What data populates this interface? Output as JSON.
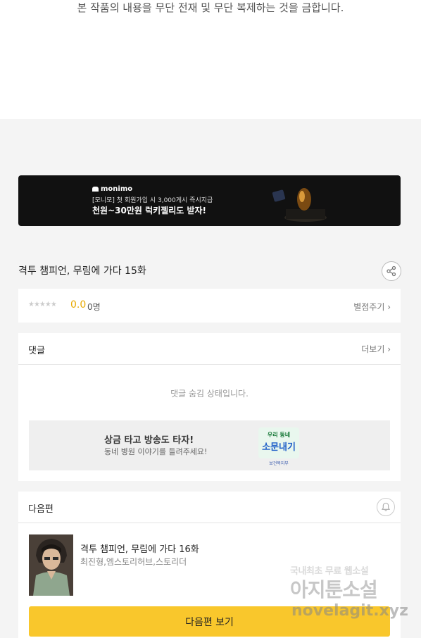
{
  "notice": {
    "copyright": "본 작품의 내용을 무단 전재 및 무단 복제하는 것을 금합니다."
  },
  "banner": {
    "brand": "monimo",
    "sub": "[모니모] 첫 회원가입 시 3,000게시 즉시지급",
    "main": "천원~30만원 럭키젤리도 받자!"
  },
  "episode": {
    "title": "격투 챔피언, 무림에 가다 15화"
  },
  "rating": {
    "stars": "★★★★★",
    "score": "0.0",
    "count": "0명",
    "rate_link": "별점주기 ›"
  },
  "comments": {
    "label": "댓글",
    "more_link": "더보기 ›",
    "hidden_message": "댓글 숨김 상태입니다.",
    "promo_title": "상금 타고 방송도 타자!",
    "promo_sub": "동네 병원 이야기를 들려주세요!",
    "promo_logo": [
      "우리 동네",
      "소문내기"
    ],
    "promo_org": "보건복지부"
  },
  "next": {
    "label": "다음편",
    "title": "격투 챔피언, 무림에 가다 16화",
    "authors": "최진형,엠스토리허브,스토리더",
    "button": "다음편 보기"
  },
  "watermark": {
    "line1": "국내최초 무료 웹소설",
    "line2": "아지툰소설",
    "line3": "novelagit.xyz"
  },
  "colors": {
    "accent": "#f9c72c",
    "score": "#e8a900"
  }
}
